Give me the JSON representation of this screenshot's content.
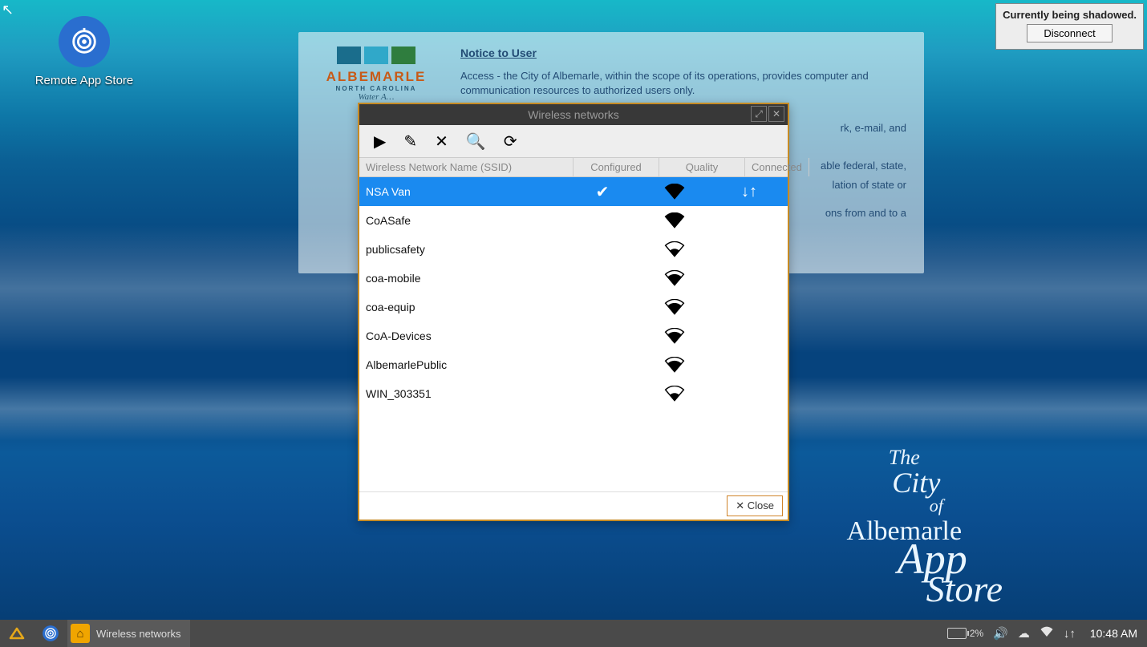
{
  "desktop_icon": {
    "label": "Remote App Store"
  },
  "shadow": {
    "text": "Currently being shadowed.",
    "button": "Disconnect"
  },
  "notice": {
    "logo_word": "ALBEMARLE",
    "logo_sub": "NORTH CAROLINA",
    "logo_script": "Water A…",
    "title": "Notice to User",
    "p1": "Access - the City of Albemarle, within the scope of its operations, provides computer and communication resources to authorized users only.",
    "p2": "**********",
    "p3_frag1": "rk, e-mail, and",
    "p4_frag": "able federal, state,",
    "p5_frag": "lation of state or",
    "p6_frag": "ons from and to a"
  },
  "city": {
    "l1": "The",
    "l2": "City",
    "l3": "of",
    "l4": "Albemarle",
    "l5": "App",
    "l6": "Store"
  },
  "window": {
    "title": "Wireless networks",
    "columns": {
      "ssid": "Wireless Network Name (SSID)",
      "configured": "Configured",
      "quality": "Quality",
      "connected": "Connected"
    },
    "close": "✕ Close",
    "rows": [
      {
        "ssid": "NSA Van",
        "configured": true,
        "quality": 4,
        "connected": true,
        "selected": true
      },
      {
        "ssid": "CoASafe",
        "configured": false,
        "quality": 4,
        "connected": false
      },
      {
        "ssid": "publicsafety",
        "configured": false,
        "quality": 2,
        "connected": false
      },
      {
        "ssid": "coa-mobile",
        "configured": false,
        "quality": 3,
        "connected": false
      },
      {
        "ssid": "coa-equip",
        "configured": false,
        "quality": 3,
        "connected": false
      },
      {
        "ssid": "CoA-Devices",
        "configured": false,
        "quality": 3,
        "connected": false
      },
      {
        "ssid": "AlbemarlePublic",
        "configured": false,
        "quality": 3,
        "connected": false
      },
      {
        "ssid": "WIN_303351",
        "configured": false,
        "quality": 2,
        "connected": false
      }
    ]
  },
  "taskbar": {
    "task_label": "Wireless networks",
    "battery_pct": "2%",
    "clock": "10:48 AM"
  }
}
